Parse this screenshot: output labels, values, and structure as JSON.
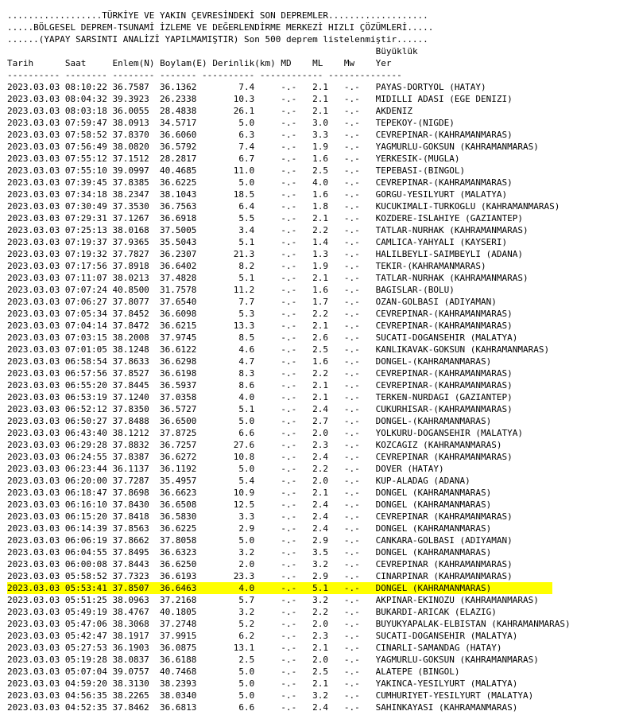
{
  "header_lines": [
    "..................TÜRKİYE VE YAKIN ÇEVRESİNDEKİ SON DEPREMLER...................",
    ".....BÖLGESEL DEPREM-TSUNAMİ İZLEME VE DEĞERLENDİRME MERKEZİ HIZLI ÇÖZÜMLERİ.....",
    "......(YAPAY SARSINTI ANALİZİ YAPILMAMIŞTIR) Son 500 deprem listelenmiştir......"
  ],
  "magnitude_heading": "Büyüklük",
  "columns": {
    "tarih": "Tarih",
    "saat": "Saat",
    "enlem": "Enlem(N)",
    "boylam": "Boylam(E)",
    "derinlik": "Derinlik(km)",
    "md": "MD",
    "ml": "ML",
    "mw": "Mw",
    "yer": "Yer"
  },
  "separator": "---------- -------- -------- ------- ---------- ------------ --------------",
  "highlight_color": "#ffff00",
  "highlighted_row": 42,
  "rows": [
    [
      "2023.03.03",
      "08:10:22",
      "36.7587",
      "36.1362",
      "7.4",
      "-.-",
      "2.1",
      "-.-",
      "PAYAS-DORTYOL (HATAY)"
    ],
    [
      "2023.03.03",
      "08:04:32",
      "39.3923",
      "26.2338",
      "10.3",
      "-.-",
      "2.1",
      "-.-",
      "MIDILLI ADASI (EGE DENIZI)"
    ],
    [
      "2023.03.03",
      "08:03:18",
      "36.0055",
      "28.4838",
      "26.1",
      "-.-",
      "2.1",
      "-.-",
      "AKDENIZ"
    ],
    [
      "2023.03.03",
      "07:59:47",
      "38.0913",
      "34.5717",
      "5.0",
      "-.-",
      "3.0",
      "-.-",
      "TEPEKOY-(NIGDE)"
    ],
    [
      "2023.03.03",
      "07:58:52",
      "37.8370",
      "36.6060",
      "6.3",
      "-.-",
      "3.3",
      "-.-",
      "CEVREPINAR-(KAHRAMANMARAS)"
    ],
    [
      "2023.03.03",
      "07:56:49",
      "38.0820",
      "36.5792",
      "7.4",
      "-.-",
      "1.9",
      "-.-",
      "YAGMURLU-GOKSUN (KAHRAMANMARAS)"
    ],
    [
      "2023.03.03",
      "07:55:12",
      "37.1512",
      "28.2817",
      "6.7",
      "-.-",
      "1.6",
      "-.-",
      "YERKESIK-(MUGLA)"
    ],
    [
      "2023.03.03",
      "07:55:10",
      "39.0997",
      "40.4685",
      "11.0",
      "-.-",
      "2.5",
      "-.-",
      "TEPEBASI-(BINGOL)"
    ],
    [
      "2023.03.03",
      "07:39:45",
      "37.8385",
      "36.6225",
      "5.0",
      "-.-",
      "4.0",
      "-.-",
      "CEVREPINAR-(KAHRAMANMARAS)"
    ],
    [
      "2023.03.03",
      "07:34:18",
      "38.2347",
      "38.1043",
      "18.5",
      "-.-",
      "1.6",
      "-.-",
      "GORGU-YESILYURT (MALATYA)"
    ],
    [
      "2023.03.03",
      "07:30:49",
      "37.3530",
      "36.7563",
      "6.4",
      "-.-",
      "1.8",
      "-.-",
      "KUCUKIMALI-TURKOGLU (KAHRAMANMARAS)"
    ],
    [
      "2023.03.03",
      "07:29:31",
      "37.1267",
      "36.6918",
      "5.5",
      "-.-",
      "2.1",
      "-.-",
      "KOZDERE-ISLAHIYE (GAZIANTEP)"
    ],
    [
      "2023.03.03",
      "07:25:13",
      "38.0168",
      "37.5005",
      "3.4",
      "-.-",
      "2.2",
      "-.-",
      "TATLAR-NURHAK (KAHRAMANMARAS)"
    ],
    [
      "2023.03.03",
      "07:19:37",
      "37.9365",
      "35.5043",
      "5.1",
      "-.-",
      "1.4",
      "-.-",
      "CAMLICA-YAHYALI (KAYSERI)"
    ],
    [
      "2023.03.03",
      "07:19:32",
      "37.7827",
      "36.2307",
      "21.3",
      "-.-",
      "1.3",
      "-.-",
      "HALILBEYLI-SAIMBEYLI (ADANA)"
    ],
    [
      "2023.03.03",
      "07:17:56",
      "37.8918",
      "36.6402",
      "8.2",
      "-.-",
      "1.9",
      "-.-",
      "TEKIR-(KAHRAMANMARAS)"
    ],
    [
      "2023.03.03",
      "07:11:07",
      "38.0213",
      "37.4828",
      "5.1",
      "-.-",
      "2.1",
      "-.-",
      "TATLAR-NURHAK (KAHRAMANMARAS)"
    ],
    [
      "2023.03.03",
      "07:07:24",
      "40.8500",
      "31.7578",
      "11.2",
      "-.-",
      "1.6",
      "-.-",
      "BAGISLAR-(BOLU)"
    ],
    [
      "2023.03.03",
      "07:06:27",
      "37.8077",
      "37.6540",
      "7.7",
      "-.-",
      "1.7",
      "-.-",
      "OZAN-GOLBASI (ADIYAMAN)"
    ],
    [
      "2023.03.03",
      "07:05:34",
      "37.8452",
      "36.6098",
      "5.3",
      "-.-",
      "2.2",
      "-.-",
      "CEVREPINAR-(KAHRAMANMARAS)"
    ],
    [
      "2023.03.03",
      "07:04:14",
      "37.8472",
      "36.6215",
      "13.3",
      "-.-",
      "2.1",
      "-.-",
      "CEVREPINAR-(KAHRAMANMARAS)"
    ],
    [
      "2023.03.03",
      "07:03:15",
      "38.2008",
      "37.9745",
      "8.5",
      "-.-",
      "2.6",
      "-.-",
      "SUCATI-DOGANSEHIR (MALATYA)"
    ],
    [
      "2023.03.03",
      "07:01:05",
      "38.1248",
      "36.6122",
      "4.6",
      "-.-",
      "2.5",
      "-.-",
      "KANLIKAVAK-GOKSUN (KAHRAMANMARAS)"
    ],
    [
      "2023.03.03",
      "06:58:54",
      "37.8633",
      "36.6298",
      "4.7",
      "-.-",
      "1.6",
      "-.-",
      "DONGEL-(KAHRAMANMARAS)"
    ],
    [
      "2023.03.03",
      "06:57:56",
      "37.8527",
      "36.6198",
      "8.3",
      "-.-",
      "2.2",
      "-.-",
      "CEVREPINAR-(KAHRAMANMARAS)"
    ],
    [
      "2023.03.03",
      "06:55:20",
      "37.8445",
      "36.5937",
      "8.6",
      "-.-",
      "2.1",
      "-.-",
      "CEVREPINAR-(KAHRAMANMARAS)"
    ],
    [
      "2023.03.03",
      "06:53:19",
      "37.1240",
      "37.0358",
      "4.0",
      "-.-",
      "2.1",
      "-.-",
      "TERKEN-NURDAGI (GAZIANTEP)"
    ],
    [
      "2023.03.03",
      "06:52:12",
      "37.8350",
      "36.5727",
      "5.1",
      "-.-",
      "2.4",
      "-.-",
      "CUKURHISAR-(KAHRAMANMARAS)"
    ],
    [
      "2023.03.03",
      "06:50:27",
      "37.8488",
      "36.6500",
      "5.0",
      "-.-",
      "2.7",
      "-.-",
      "DONGEL-(KAHRAMANMARAS)"
    ],
    [
      "2023.03.03",
      "06:43:40",
      "38.1212",
      "37.8725",
      "6.6",
      "-.-",
      "2.0",
      "-.-",
      "YOLKURU-DOGANSEHIR (MALATYA)"
    ],
    [
      "2023.03.03",
      "06:29:28",
      "37.8832",
      "36.7257",
      "27.6",
      "-.-",
      "2.3",
      "-.-",
      "KOZCAGIZ (KAHRAMANMARAS)"
    ],
    [
      "2023.03.03",
      "06:24:55",
      "37.8387",
      "36.6272",
      "10.8",
      "-.-",
      "2.4",
      "-.-",
      "CEVREPINAR (KAHRAMANMARAS)"
    ],
    [
      "2023.03.03",
      "06:23:44",
      "36.1137",
      "36.1192",
      "5.0",
      "-.-",
      "2.2",
      "-.-",
      "DOVER (HATAY)"
    ],
    [
      "2023.03.03",
      "06:20:00",
      "37.7287",
      "35.4957",
      "5.4",
      "-.-",
      "2.0",
      "-.-",
      "KUP-ALADAG (ADANA)"
    ],
    [
      "2023.03.03",
      "06:18:47",
      "37.8698",
      "36.6623",
      "10.9",
      "-.-",
      "2.1",
      "-.-",
      "DONGEL (KAHRAMANMARAS)"
    ],
    [
      "2023.03.03",
      "06:16:10",
      "37.8430",
      "36.6508",
      "12.5",
      "-.-",
      "2.4",
      "-.-",
      "DONGEL (KAHRAMANMARAS)"
    ],
    [
      "2023.03.03",
      "06:15:20",
      "37.8418",
      "36.5830",
      "3.3",
      "-.-",
      "2.4",
      "-.-",
      "CEVREPINAR (KAHRAMANMARAS)"
    ],
    [
      "2023.03.03",
      "06:14:39",
      "37.8563",
      "36.6225",
      "2.9",
      "-.-",
      "2.4",
      "-.-",
      "DONGEL (KAHRAMANMARAS)"
    ],
    [
      "2023.03.03",
      "06:06:19",
      "37.8662",
      "37.8058",
      "5.0",
      "-.-",
      "2.9",
      "-.-",
      "CANKARA-GOLBASI (ADIYAMAN)"
    ],
    [
      "2023.03.03",
      "06:04:55",
      "37.8495",
      "36.6323",
      "3.2",
      "-.-",
      "3.5",
      "-.-",
      "DONGEL (KAHRAMANMARAS)"
    ],
    [
      "2023.03.03",
      "06:00:08",
      "37.8443",
      "36.6250",
      "2.0",
      "-.-",
      "3.2",
      "-.-",
      "CEVREPINAR (KAHRAMANMARAS)"
    ],
    [
      "2023.03.03",
      "05:58:52",
      "37.7323",
      "36.6193",
      "23.3",
      "-.-",
      "2.9",
      "-.-",
      "CINARPINAR (KAHRAMANMARAS)"
    ],
    [
      "2023.03.03",
      "05:53:41",
      "37.8507",
      "36.6463",
      "4.0",
      "-.-",
      "5.1",
      "-.-",
      "DONGEL (KAHRAMANMARAS)"
    ],
    [
      "2023.03.03",
      "05:51:25",
      "38.0963",
      "37.2168",
      "5.7",
      "-.-",
      "3.2",
      "-.-",
      "AKPINAR-EKINOZU (KAHRAMANMARAS)"
    ],
    [
      "2023.03.03",
      "05:49:19",
      "38.4767",
      "40.1805",
      "3.2",
      "-.-",
      "2.2",
      "-.-",
      "BUKARDI-ARICAK (ELAZIG)"
    ],
    [
      "2023.03.03",
      "05:47:06",
      "38.3068",
      "37.2748",
      "5.2",
      "-.-",
      "2.0",
      "-.-",
      "BUYUKYAPALAK-ELBISTAN (KAHRAMANMARAS)"
    ],
    [
      "2023.03.03",
      "05:42:47",
      "38.1917",
      "37.9915",
      "6.2",
      "-.-",
      "2.3",
      "-.-",
      "SUCATI-DOGANSEHIR (MALATYA)"
    ],
    [
      "2023.03.03",
      "05:27:53",
      "36.1903",
      "36.0875",
      "13.1",
      "-.-",
      "2.1",
      "-.-",
      "CINARLI-SAMANDAG (HATAY)"
    ],
    [
      "2023.03.03",
      "05:19:28",
      "38.0837",
      "36.6188",
      "2.5",
      "-.-",
      "2.0",
      "-.-",
      "YAGMURLU-GOKSUN (KAHRAMANMARAS)"
    ],
    [
      "2023.03.03",
      "05:07:04",
      "39.0757",
      "40.7468",
      "5.0",
      "-.-",
      "2.5",
      "-.-",
      "ALATEPE (BINGOL)"
    ],
    [
      "2023.03.03",
      "04:59:20",
      "38.3130",
      "38.2393",
      "5.0",
      "-.-",
      "2.1",
      "-.-",
      "YAKINCA-YESILYURT (MALATYA)"
    ],
    [
      "2023.03.03",
      "04:56:35",
      "38.2265",
      "38.0340",
      "5.0",
      "-.-",
      "3.2",
      "-.-",
      "CUMHURIYET-YESILYURT (MALATYA)"
    ],
    [
      "2023.03.03",
      "04:52:35",
      "37.8462",
      "36.6813",
      "6.6",
      "-.-",
      "2.4",
      "-.-",
      "SAHINKAYASI (KAHRAMANMARAS)"
    ]
  ]
}
